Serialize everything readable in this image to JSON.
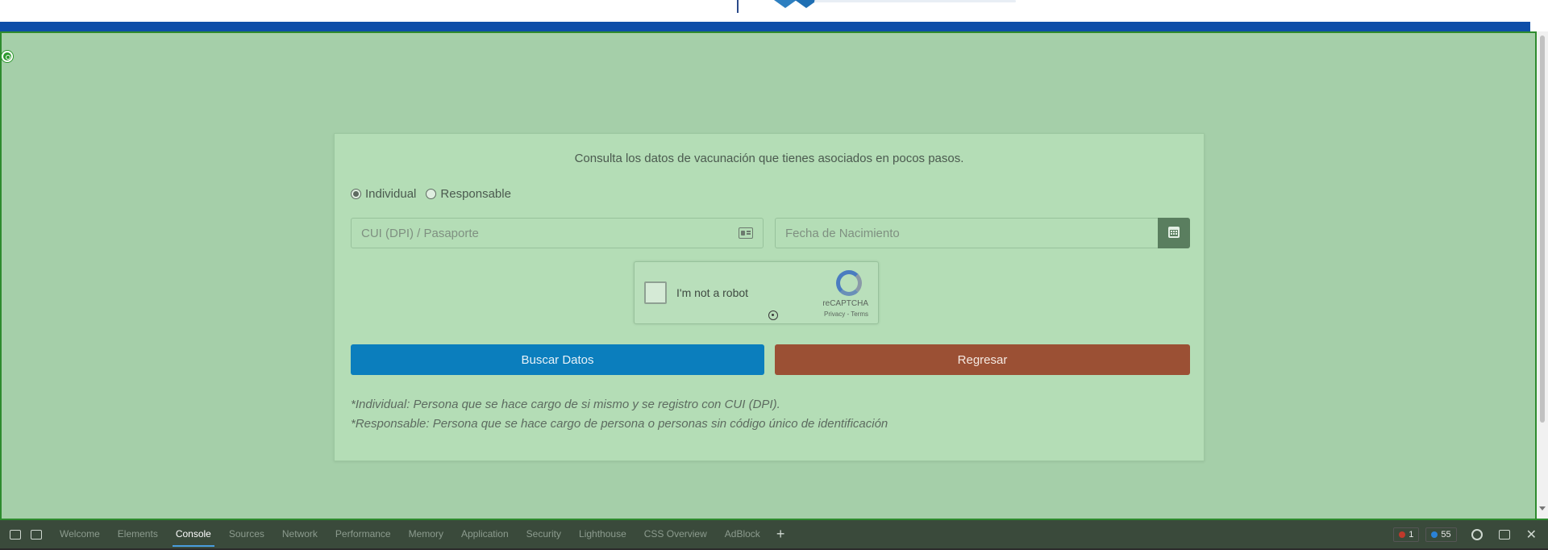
{
  "form": {
    "intro": "Consulta los datos de vacunación que tienes asociados en pocos pasos.",
    "radio_individual": "Individual",
    "radio_responsable": "Responsable",
    "cui_placeholder": "CUI (DPI) / Pasaporte",
    "date_placeholder": "Fecha de Nacimiento",
    "search_button": "Buscar Datos",
    "back_button": "Regresar",
    "note_individual": "*Individual: Persona que se hace cargo de si mismo y se registro con CUI (DPI).",
    "note_responsable": "*Responsable: Persona que se hace cargo de persona o personas sin código único de identificación"
  },
  "captcha": {
    "label": "I'm not a robot",
    "brand": "reCAPTCHA",
    "links": "Privacy - Terms",
    "icon": "recaptcha-icon"
  },
  "devtools": {
    "tabs": [
      "Welcome",
      "Elements",
      "Console",
      "Sources",
      "Network",
      "Performance",
      "Memory",
      "Application",
      "Security",
      "Lighthouse",
      "CSS Overview",
      "AdBlock"
    ],
    "active_tab": "Console",
    "errors": "1",
    "messages": "55"
  },
  "colors": {
    "overlay": "#a5cfa9",
    "card": "#b4ddb6",
    "search_button": "#0b7ebd",
    "back_button": "#9b5034",
    "header_bar": "#0e4ea8"
  }
}
